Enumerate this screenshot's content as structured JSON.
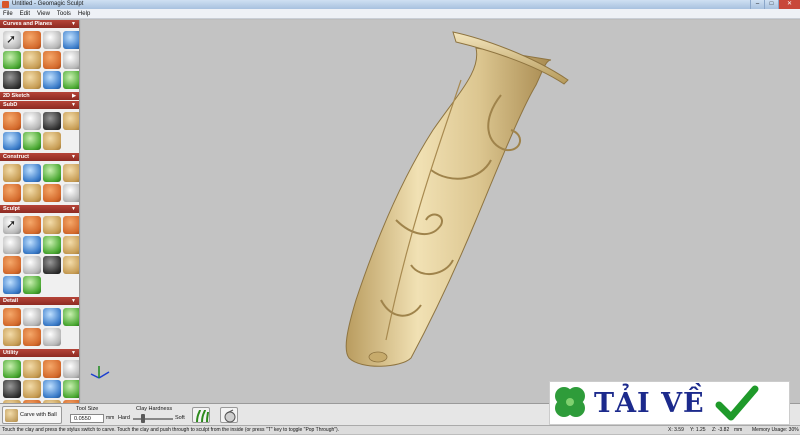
{
  "window": {
    "title": "Untitled - Geomagic Sculpt"
  },
  "menu": [
    "File",
    "Edit",
    "View",
    "Tools",
    "Help"
  ],
  "sidebar": {
    "sections": [
      {
        "label": "Curves and Planes",
        "icons": [
          "select-arrow-icon",
          "pen-curve-icon",
          "curve-tool-icon",
          "spline-icon",
          "line-tool-icon",
          "mirror-icon",
          "plane-icon",
          "sphere-icon",
          "grid-icon",
          "bend-icon",
          "extrude-icon",
          "sheet-icon"
        ]
      },
      {
        "label": "2D Sketch",
        "icons": []
      },
      {
        "label": "SubD",
        "icons": [
          "subd-box-icon",
          "subd-cube-icon",
          "subd-ring-icon",
          "subd-tube-icon",
          "subd-edge-icon",
          "subd-fold-icon",
          "subd-pipe-icon"
        ]
      },
      {
        "label": "Construct",
        "icons": [
          "construct-pipe-icon",
          "construct-bend-icon",
          "construct-rock-icon",
          "construct-sphere-icon",
          "construct-shell-icon",
          "construct-lump-icon",
          "construct-stone-icon",
          "construct-shape-icon"
        ]
      },
      {
        "label": "Sculpt",
        "icons": [
          "sculpt-arrow-icon",
          "sculpt-stamp-icon",
          "sculpt-smudge-icon",
          "sculpt-fire-icon",
          "sculpt-brush-icon",
          "sculpt-smooth-icon",
          "sculpt-emboss-icon",
          "sculpt-layer-icon",
          "sculpt-flat-icon",
          "sculpt-wave-icon",
          "sculpt-block-icon",
          "sculpt-figure-icon",
          "sculpt-sphere-icon",
          "sculpt-mask-icon"
        ]
      },
      {
        "label": "Detail",
        "icons": [
          "detail-face-icon",
          "detail-shell-icon",
          "detail-pattern-icon",
          "detail-ball-icon",
          "detail-gear-icon",
          "detail-fish-icon",
          "detail-color-icon"
        ]
      },
      {
        "label": "Utility",
        "icons": [
          "utility-box-icon",
          "utility-grid-icon",
          "utility-knife-icon",
          "utility-pen-icon",
          "utility-blocks-icon",
          "utility-frame-icon",
          "utility-scale-icon",
          "utility-star-icon",
          "utility-move-icon",
          "utility-globe-icon",
          "utility-sphere-icon",
          "utility-eye-icon"
        ]
      },
      {
        "label": "Visibility",
        "icons": []
      }
    ]
  },
  "bottombar": {
    "tool_label": "Carve with Ball",
    "tool_size_label": "Tool Size",
    "tool_size_value": "0.0550",
    "tool_size_unit": "mm",
    "clay_hardness_label": "Clay Hardness",
    "hard_label": "Hard",
    "soft_label": "Soft",
    "clay_hardness": 0.25
  },
  "status": {
    "hint": "Touch the clay and press the stylus switch to carve. Touch the clay and push through to sculpt from the inside (or press \"T\" key to toggle \"Pop Through\").",
    "x": "X: 3.59",
    "y": "Y: 1.25",
    "z": "Z: -3.82",
    "unit": "mm",
    "memory": "Memory Usage: 30%"
  },
  "watermark": {
    "text": "TẢI VỀ"
  },
  "colors": {
    "accent": "#9b3228",
    "clay": "#dcc690",
    "viewport_bg": "#c3c3c3"
  }
}
